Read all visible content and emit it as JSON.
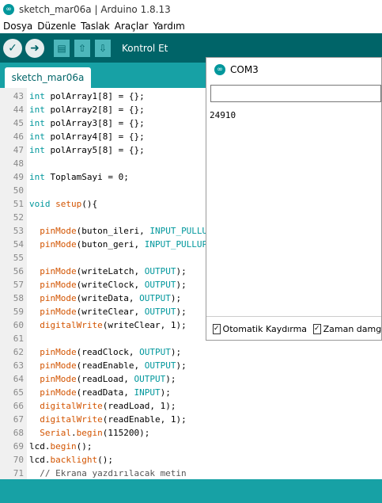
{
  "window": {
    "title": "sketch_mar06a | Arduino 1.8.13"
  },
  "menu": [
    "Dosya",
    "Düzenle",
    "Taslak",
    "Araçlar",
    "Yardım"
  ],
  "toolbar": {
    "hover_label": "Kontrol Et"
  },
  "tabs": [
    {
      "label": "sketch_mar06a"
    }
  ],
  "editor": {
    "lines": [
      {
        "n": "43",
        "segs": [
          {
            "t": "int",
            "c": "kw"
          },
          {
            "t": " polArray1[8] = {};",
            "c": ""
          }
        ]
      },
      {
        "n": "44",
        "segs": [
          {
            "t": "int",
            "c": "kw"
          },
          {
            "t": " polArray2[8] = {};",
            "c": ""
          }
        ]
      },
      {
        "n": "45",
        "segs": [
          {
            "t": "int",
            "c": "kw"
          },
          {
            "t": " polArray3[8] = {};",
            "c": ""
          }
        ]
      },
      {
        "n": "46",
        "segs": [
          {
            "t": "int",
            "c": "kw"
          },
          {
            "t": " polArray4[8] = {};",
            "c": ""
          }
        ]
      },
      {
        "n": "47",
        "segs": [
          {
            "t": "int",
            "c": "kw"
          },
          {
            "t": " polArray5[8] = {};",
            "c": ""
          }
        ]
      },
      {
        "n": "48",
        "segs": []
      },
      {
        "n": "49",
        "segs": [
          {
            "t": "int",
            "c": "kw"
          },
          {
            "t": " ToplamSayi = 0;",
            "c": ""
          }
        ]
      },
      {
        "n": "50",
        "segs": []
      },
      {
        "n": "51",
        "segs": [
          {
            "t": "void",
            "c": "kw"
          },
          {
            "t": " ",
            "c": ""
          },
          {
            "t": "setup",
            "c": "fn"
          },
          {
            "t": "(){",
            "c": ""
          }
        ]
      },
      {
        "n": "52",
        "segs": []
      },
      {
        "n": "53",
        "segs": [
          {
            "t": "  ",
            "c": ""
          },
          {
            "t": "pinMode",
            "c": "fn"
          },
          {
            "t": "(buton_ileri, ",
            "c": ""
          },
          {
            "t": "INPUT_PULLUP",
            "c": "kw"
          },
          {
            "t": ");",
            "c": ""
          }
        ]
      },
      {
        "n": "54",
        "segs": [
          {
            "t": "  ",
            "c": ""
          },
          {
            "t": "pinMode",
            "c": "fn"
          },
          {
            "t": "(buton_geri, ",
            "c": ""
          },
          {
            "t": "INPUT_PULLUP",
            "c": "kw"
          },
          {
            "t": ");",
            "c": ""
          }
        ]
      },
      {
        "n": "55",
        "segs": []
      },
      {
        "n": "56",
        "segs": [
          {
            "t": "  ",
            "c": ""
          },
          {
            "t": "pinMode",
            "c": "fn"
          },
          {
            "t": "(writeLatch, ",
            "c": ""
          },
          {
            "t": "OUTPUT",
            "c": "kw"
          },
          {
            "t": ");",
            "c": ""
          }
        ]
      },
      {
        "n": "57",
        "segs": [
          {
            "t": "  ",
            "c": ""
          },
          {
            "t": "pinMode",
            "c": "fn"
          },
          {
            "t": "(writeClock, ",
            "c": ""
          },
          {
            "t": "OUTPUT",
            "c": "kw"
          },
          {
            "t": ");",
            "c": ""
          }
        ]
      },
      {
        "n": "58",
        "segs": [
          {
            "t": "  ",
            "c": ""
          },
          {
            "t": "pinMode",
            "c": "fn"
          },
          {
            "t": "(writeData, ",
            "c": ""
          },
          {
            "t": "OUTPUT",
            "c": "kw"
          },
          {
            "t": ");",
            "c": ""
          }
        ]
      },
      {
        "n": "59",
        "segs": [
          {
            "t": "  ",
            "c": ""
          },
          {
            "t": "pinMode",
            "c": "fn"
          },
          {
            "t": "(writeClear, ",
            "c": ""
          },
          {
            "t": "OUTPUT",
            "c": "kw"
          },
          {
            "t": ");",
            "c": ""
          }
        ]
      },
      {
        "n": "60",
        "segs": [
          {
            "t": "  ",
            "c": ""
          },
          {
            "t": "digitalWrite",
            "c": "fn"
          },
          {
            "t": "(writeClear, 1);",
            "c": ""
          }
        ]
      },
      {
        "n": "61",
        "segs": []
      },
      {
        "n": "62",
        "segs": [
          {
            "t": "  ",
            "c": ""
          },
          {
            "t": "pinMode",
            "c": "fn"
          },
          {
            "t": "(readClock, ",
            "c": ""
          },
          {
            "t": "OUTPUT",
            "c": "kw"
          },
          {
            "t": ");",
            "c": ""
          }
        ]
      },
      {
        "n": "63",
        "segs": [
          {
            "t": "  ",
            "c": ""
          },
          {
            "t": "pinMode",
            "c": "fn"
          },
          {
            "t": "(readEnable, ",
            "c": ""
          },
          {
            "t": "OUTPUT",
            "c": "kw"
          },
          {
            "t": ");",
            "c": ""
          }
        ]
      },
      {
        "n": "64",
        "segs": [
          {
            "t": "  ",
            "c": ""
          },
          {
            "t": "pinMode",
            "c": "fn"
          },
          {
            "t": "(readLoad, ",
            "c": ""
          },
          {
            "t": "OUTPUT",
            "c": "kw"
          },
          {
            "t": ");",
            "c": ""
          }
        ]
      },
      {
        "n": "65",
        "segs": [
          {
            "t": "  ",
            "c": ""
          },
          {
            "t": "pinMode",
            "c": "fn"
          },
          {
            "t": "(readData, ",
            "c": ""
          },
          {
            "t": "INPUT",
            "c": "kw"
          },
          {
            "t": ");",
            "c": ""
          }
        ]
      },
      {
        "n": "66",
        "segs": [
          {
            "t": "  ",
            "c": ""
          },
          {
            "t": "digitalWrite",
            "c": "fn"
          },
          {
            "t": "(readLoad, 1);",
            "c": ""
          }
        ]
      },
      {
        "n": "67",
        "segs": [
          {
            "t": "  ",
            "c": ""
          },
          {
            "t": "digitalWrite",
            "c": "fn"
          },
          {
            "t": "(readEnable, 1);",
            "c": ""
          }
        ]
      },
      {
        "n": "68",
        "segs": [
          {
            "t": "  ",
            "c": ""
          },
          {
            "t": "Serial",
            "c": "fn"
          },
          {
            "t": ".",
            "c": ""
          },
          {
            "t": "begin",
            "c": "fn"
          },
          {
            "t": "(115200);",
            "c": ""
          }
        ]
      },
      {
        "n": "69",
        "segs": [
          {
            "t": "lcd.",
            "c": ""
          },
          {
            "t": "begin",
            "c": "fn"
          },
          {
            "t": "();",
            "c": ""
          }
        ]
      },
      {
        "n": "70",
        "segs": [
          {
            "t": "lcd.",
            "c": ""
          },
          {
            "t": "backlight",
            "c": "fn"
          },
          {
            "t": "();",
            "c": ""
          }
        ]
      },
      {
        "n": "71",
        "segs": [
          {
            "t": "  // Ekrana yazdırılacak metin",
            "c": "cm"
          }
        ]
      }
    ]
  },
  "serial_monitor": {
    "title": "COM3",
    "input_value": "",
    "output": "24910",
    "autoscroll_label": "Otomatik Kaydırma",
    "autoscroll_checked": true,
    "timestamp_label": "Zaman damgasını",
    "timestamp_checked": true
  },
  "colors": {
    "toolbar_bg": "#006468",
    "tab_bg": "#17a1a5",
    "keyword": "#00979c",
    "function": "#d35400"
  },
  "icons": [
    "arduino-logo-icon",
    "verify-check-icon",
    "upload-arrow-icon",
    "new-file-icon",
    "open-file-icon",
    "save-file-icon",
    "arduino-logo-icon"
  ]
}
